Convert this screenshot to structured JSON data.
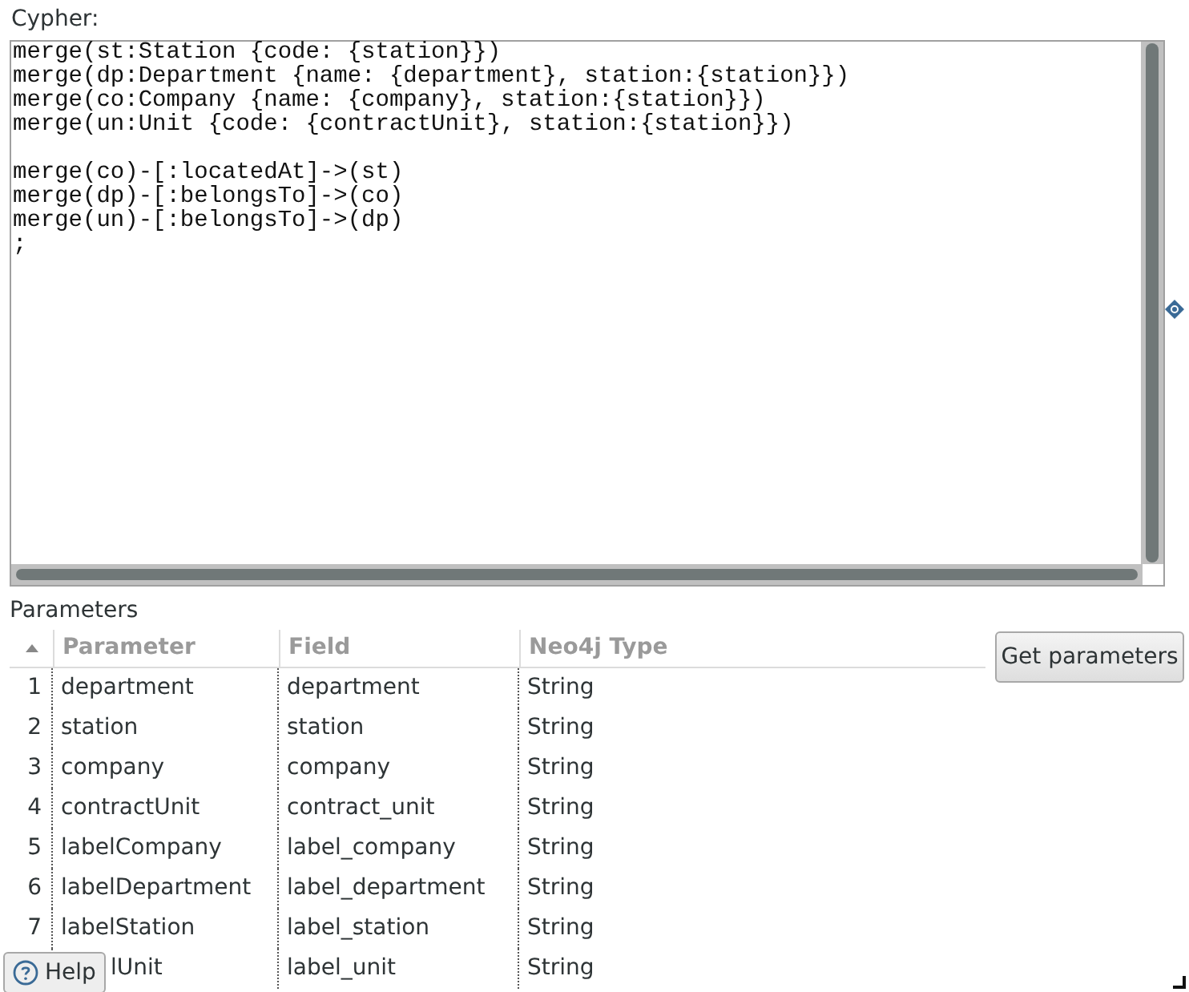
{
  "cypher_label": "Cypher:",
  "code_blocks": [
    [
      "merge(st:Station {code: {station}})",
      "merge(dp:Department {name: {department}, station:{station}})",
      "merge(co:Company {name: {company}, station:{station}})",
      "merge(un:Unit {code: {contractUnit}, station:{station}})"
    ],
    [
      "merge(co)-[:locatedAt]->(st)",
      "merge(dp)-[:belongsTo]->(co)",
      "merge(un)-[:belongsTo]->(dp)",
      ";"
    ]
  ],
  "parameters_label": "Parameters",
  "table": {
    "columns": [
      "Parameter",
      "Field",
      "Neo4j Type"
    ],
    "rows": [
      {
        "number": "1",
        "parameter": "department",
        "field": "department",
        "type": "String"
      },
      {
        "number": "2",
        "parameter": "station",
        "field": "station",
        "type": "String"
      },
      {
        "number": "3",
        "parameter": "company",
        "field": "company",
        "type": "String"
      },
      {
        "number": "4",
        "parameter": "contractUnit",
        "field": "contract_unit",
        "type": "String"
      },
      {
        "number": "5",
        "parameter": "labelCompany",
        "field": "label_company",
        "type": "String"
      },
      {
        "number": "6",
        "parameter": "labelDepartment",
        "field": "label_department",
        "type": "String"
      },
      {
        "number": "7",
        "parameter": "labelStation",
        "field": "label_station",
        "type": "String"
      },
      {
        "number": "",
        "parameter": "lUnit",
        "field": "label_unit",
        "type": "String"
      }
    ]
  },
  "get_parameters_button": "Get parameters",
  "help_button": "Help"
}
